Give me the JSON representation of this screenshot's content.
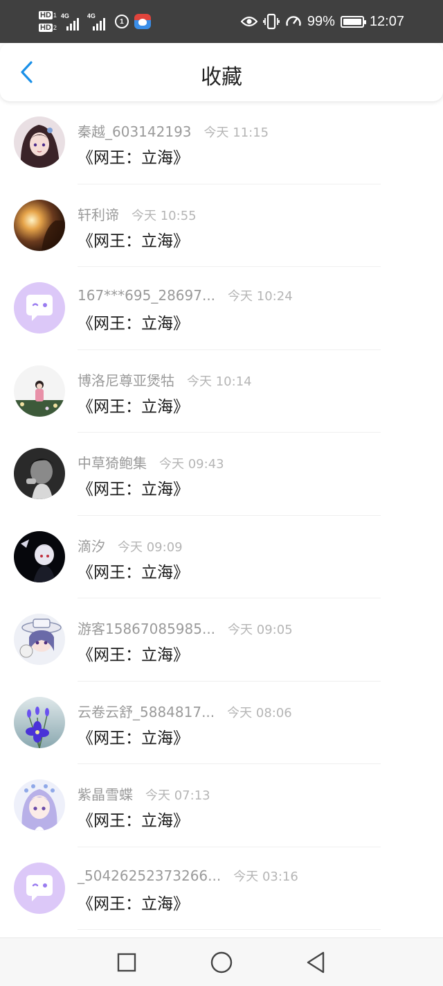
{
  "status_bar": {
    "hd1": "HD",
    "hd1_num": "1",
    "hd2": "HD",
    "hd2_num": "2",
    "net1": "4G",
    "net2": "4G",
    "circle_badge": "1",
    "battery": "99%",
    "battery_level": 0.99,
    "time": "12:07"
  },
  "header": {
    "title": "收藏",
    "back_icon": "chevron-left-icon",
    "accent": "#1a90e8"
  },
  "favorites": [
    {
      "user": "秦越_603142193",
      "time": "今天 11:15",
      "work": "《网王：立海》",
      "avatar": "anime-girl-dark-hair"
    },
    {
      "user": "轩利谛",
      "time": "今天 10:55",
      "work": "《网王：立海》",
      "avatar": "sunset-photo"
    },
    {
      "user": "167***695_28697...",
      "time": "今天 10:24",
      "work": "《网王：立海》",
      "avatar": "default-chat-bubble"
    },
    {
      "user": "博洛尼尊亚煲牯",
      "time": "今天 10:14",
      "work": "《网王：立海》",
      "avatar": "girl-in-field"
    },
    {
      "user": "中草猗鲍集",
      "time": "今天 09:43",
      "work": "《网王：立海》",
      "avatar": "monochrome-portrait"
    },
    {
      "user": "滴汐",
      "time": "今天 09:09",
      "work": "《网王：立海》",
      "avatar": "dark-anime-character"
    },
    {
      "user": "游客15867085985...",
      "time": "今天 09:05",
      "work": "《网王：立海》",
      "avatar": "anime-hat-character"
    },
    {
      "user": "云卷云舒_5884817...",
      "time": "今天 08:06",
      "work": "《网王：立海》",
      "avatar": "purple-flowers"
    },
    {
      "user": "紫晶雪蝶",
      "time": "今天 07:13",
      "work": "《网王：立海》",
      "avatar": "anime-lavender-girl"
    },
    {
      "user": "_50426252373266...",
      "time": "今天 03:16",
      "work": "《网王：立海》",
      "avatar": "default-chat-bubble"
    }
  ],
  "nav_bar": {
    "recents_icon": "square-icon",
    "home_icon": "circle-icon",
    "back_icon": "triangle-back-icon"
  },
  "colors": {
    "status_bar_bg": "#404040",
    "default_avatar_bg": "#dcc8f8",
    "default_avatar_fg": "#ffffff",
    "default_avatar_mark": "#9a7cf0"
  }
}
